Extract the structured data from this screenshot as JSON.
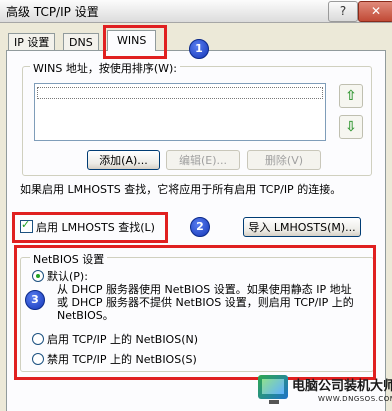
{
  "window": {
    "title": "高级 TCP/IP 设置",
    "help_label": "?",
    "close_label": "✕"
  },
  "tabs": [
    {
      "label": "IP 设置"
    },
    {
      "label": "DNS"
    },
    {
      "label": "WINS",
      "active": true
    }
  ],
  "wins": {
    "group_label": "WINS 地址，按使用排序(W):",
    "addresses": [],
    "up_icon": "arrow-up-icon",
    "down_icon": "arrow-down-icon",
    "add_label": "添加(A)...",
    "edit_label": "编辑(E)...",
    "delete_label": "删除(V)"
  },
  "lmhosts": {
    "description": "如果启用 LMHOSTS 查找，它将应用于所有启用 TCP/IP 的连接。",
    "enable_label": "启用 LMHOSTS 查找(L)",
    "enable_checked": true,
    "import_label": "导入 LMHOSTS(M)..."
  },
  "netbios": {
    "group_label": "NetBIOS 设置",
    "default_label": "默认(P):",
    "default_description": "从 DHCP 服务器使用 NetBIOS 设置。如果使用静态 IP 地址或 DHCP 服务器不提供 NetBIOS 设置，则启用 TCP/IP 上的 NetBIOS。",
    "enable_label": "启用 TCP/IP 上的 NetBIOS(N)",
    "disable_label": "禁用 TCP/IP 上的 NetBIOS(S)",
    "selected": "default"
  },
  "annotations": {
    "marker_1": "1",
    "marker_2": "2",
    "marker_3": "3",
    "color": "#e02020"
  },
  "watermark": {
    "name": "电脑公司装机大师",
    "url": "WWW.DNGSOS.COM"
  }
}
